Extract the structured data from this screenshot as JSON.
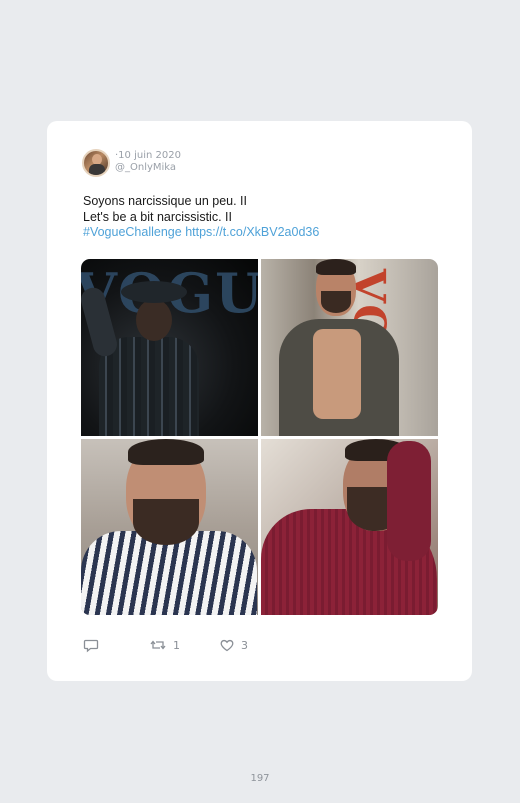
{
  "tweet": {
    "date": "·10 juin 2020",
    "handle": "@_OnlyMika",
    "text_line_1": "Soyons narcissique un peu. II",
    "text_line_2": "Let's be a bit narcissistic. II",
    "hashtag": "#VogueChallenge",
    "link": "https://t.co/XkBV2a0d36"
  },
  "photos": [
    {
      "name": "photo-1",
      "caption_text": "VOGUE"
    },
    {
      "name": "photo-2",
      "caption_text": "VOGUE"
    },
    {
      "name": "photo-3"
    },
    {
      "name": "photo-4"
    }
  ],
  "actions": {
    "reply_icon": "reply-icon",
    "retweet_icon": "retweet-icon",
    "like_icon": "heart-icon",
    "retweet_count": "1",
    "like_count": "3"
  },
  "page": {
    "number": "197",
    "background": "#e9ebee",
    "link_color": "#4fa2d8"
  }
}
